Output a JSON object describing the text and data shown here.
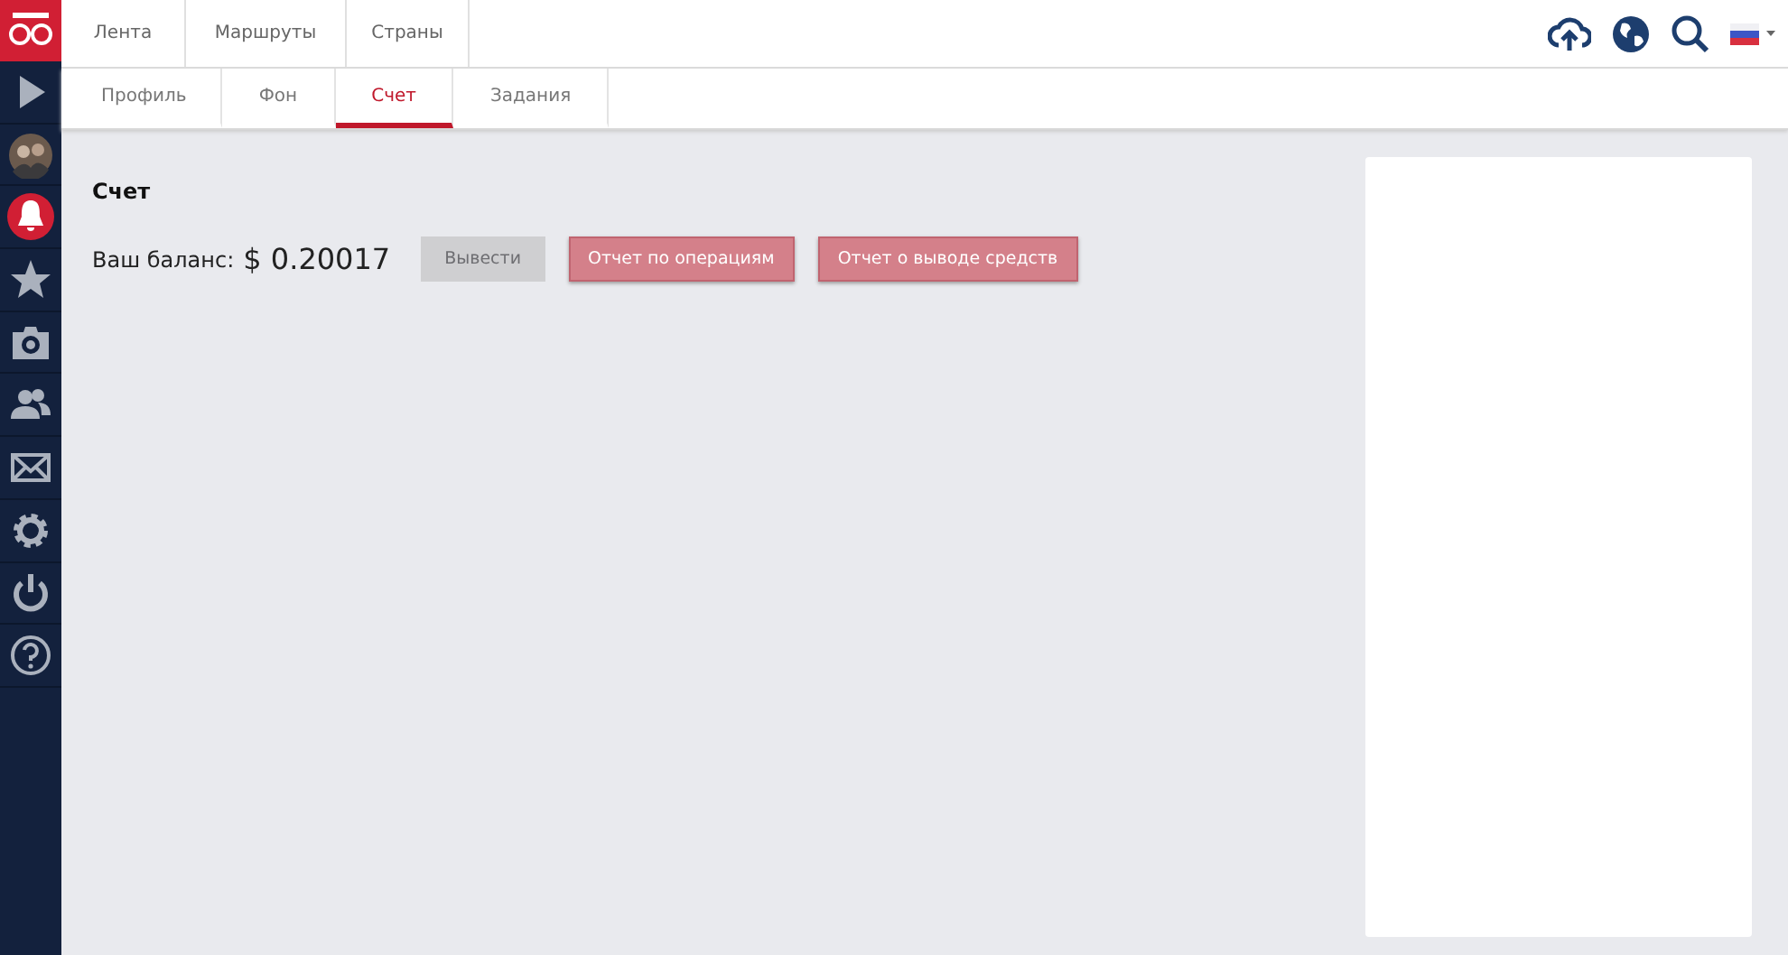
{
  "top_tabs": [
    {
      "label": "Лента",
      "selected": false
    },
    {
      "label": "Маршруты",
      "selected": false
    },
    {
      "label": "Страны",
      "selected": false
    }
  ],
  "sub_tabs": [
    {
      "label": "Профиль",
      "selected": false
    },
    {
      "label": "Фон",
      "selected": false
    },
    {
      "label": "Счет",
      "selected": true
    },
    {
      "label": "Задания",
      "selected": false
    }
  ],
  "sidebar": {
    "items": [
      {
        "selected": false
      },
      {
        "selected": false
      },
      {
        "selected": true
      },
      {
        "selected": false
      },
      {
        "selected": false
      },
      {
        "selected": false
      },
      {
        "selected": false
      },
      {
        "selected": false
      },
      {
        "selected": false
      },
      {
        "selected": false
      }
    ]
  },
  "account": {
    "title": "Счет",
    "balance_label": "Ваш баланс:",
    "balance": "$ 0.20017",
    "buttons": [
      {
        "label": "Вывести",
        "disabled": true
      },
      {
        "label": "Отчет по операциям",
        "disabled": false
      },
      {
        "label": "Отчет о выводе средств",
        "disabled": false
      }
    ]
  }
}
